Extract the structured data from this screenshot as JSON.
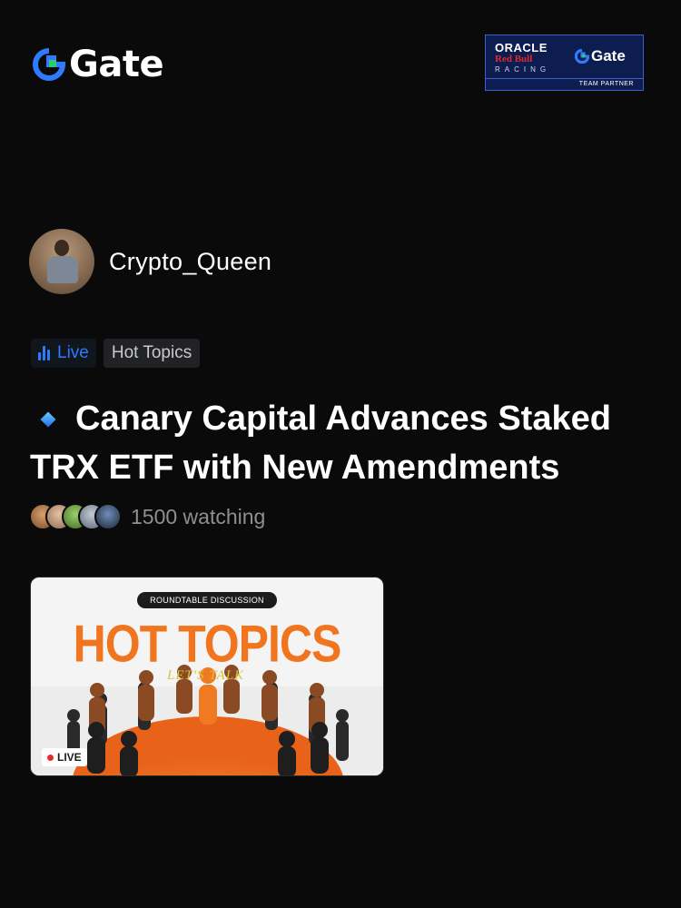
{
  "brand": {
    "logo_text": "Gate"
  },
  "partner_badge": {
    "line1": "ORACLE",
    "line2": "Red Bull",
    "line3": "RACING",
    "gate_text": "Gate",
    "footer": "TEAM PARTNER"
  },
  "author": {
    "name": "Crypto_Queen",
    "avatar_icon": "user-avatar"
  },
  "tags": {
    "live": "Live",
    "topic": "Hot Topics"
  },
  "post": {
    "title": "Canary Capital Advances Staked TRX ETF with New Amendments"
  },
  "audience": {
    "watching": "1500 watching"
  },
  "thumbnail": {
    "pill": "ROUNDTABLE DISCUSSION",
    "headline": "HOT TOPICS",
    "subline": "LET'S TALK",
    "live_badge": "LIVE"
  },
  "colors": {
    "background": "#0a0a0b",
    "accent_blue": "#2f7bff",
    "orange": "#f0751e",
    "live_red": "#e52c2c"
  }
}
